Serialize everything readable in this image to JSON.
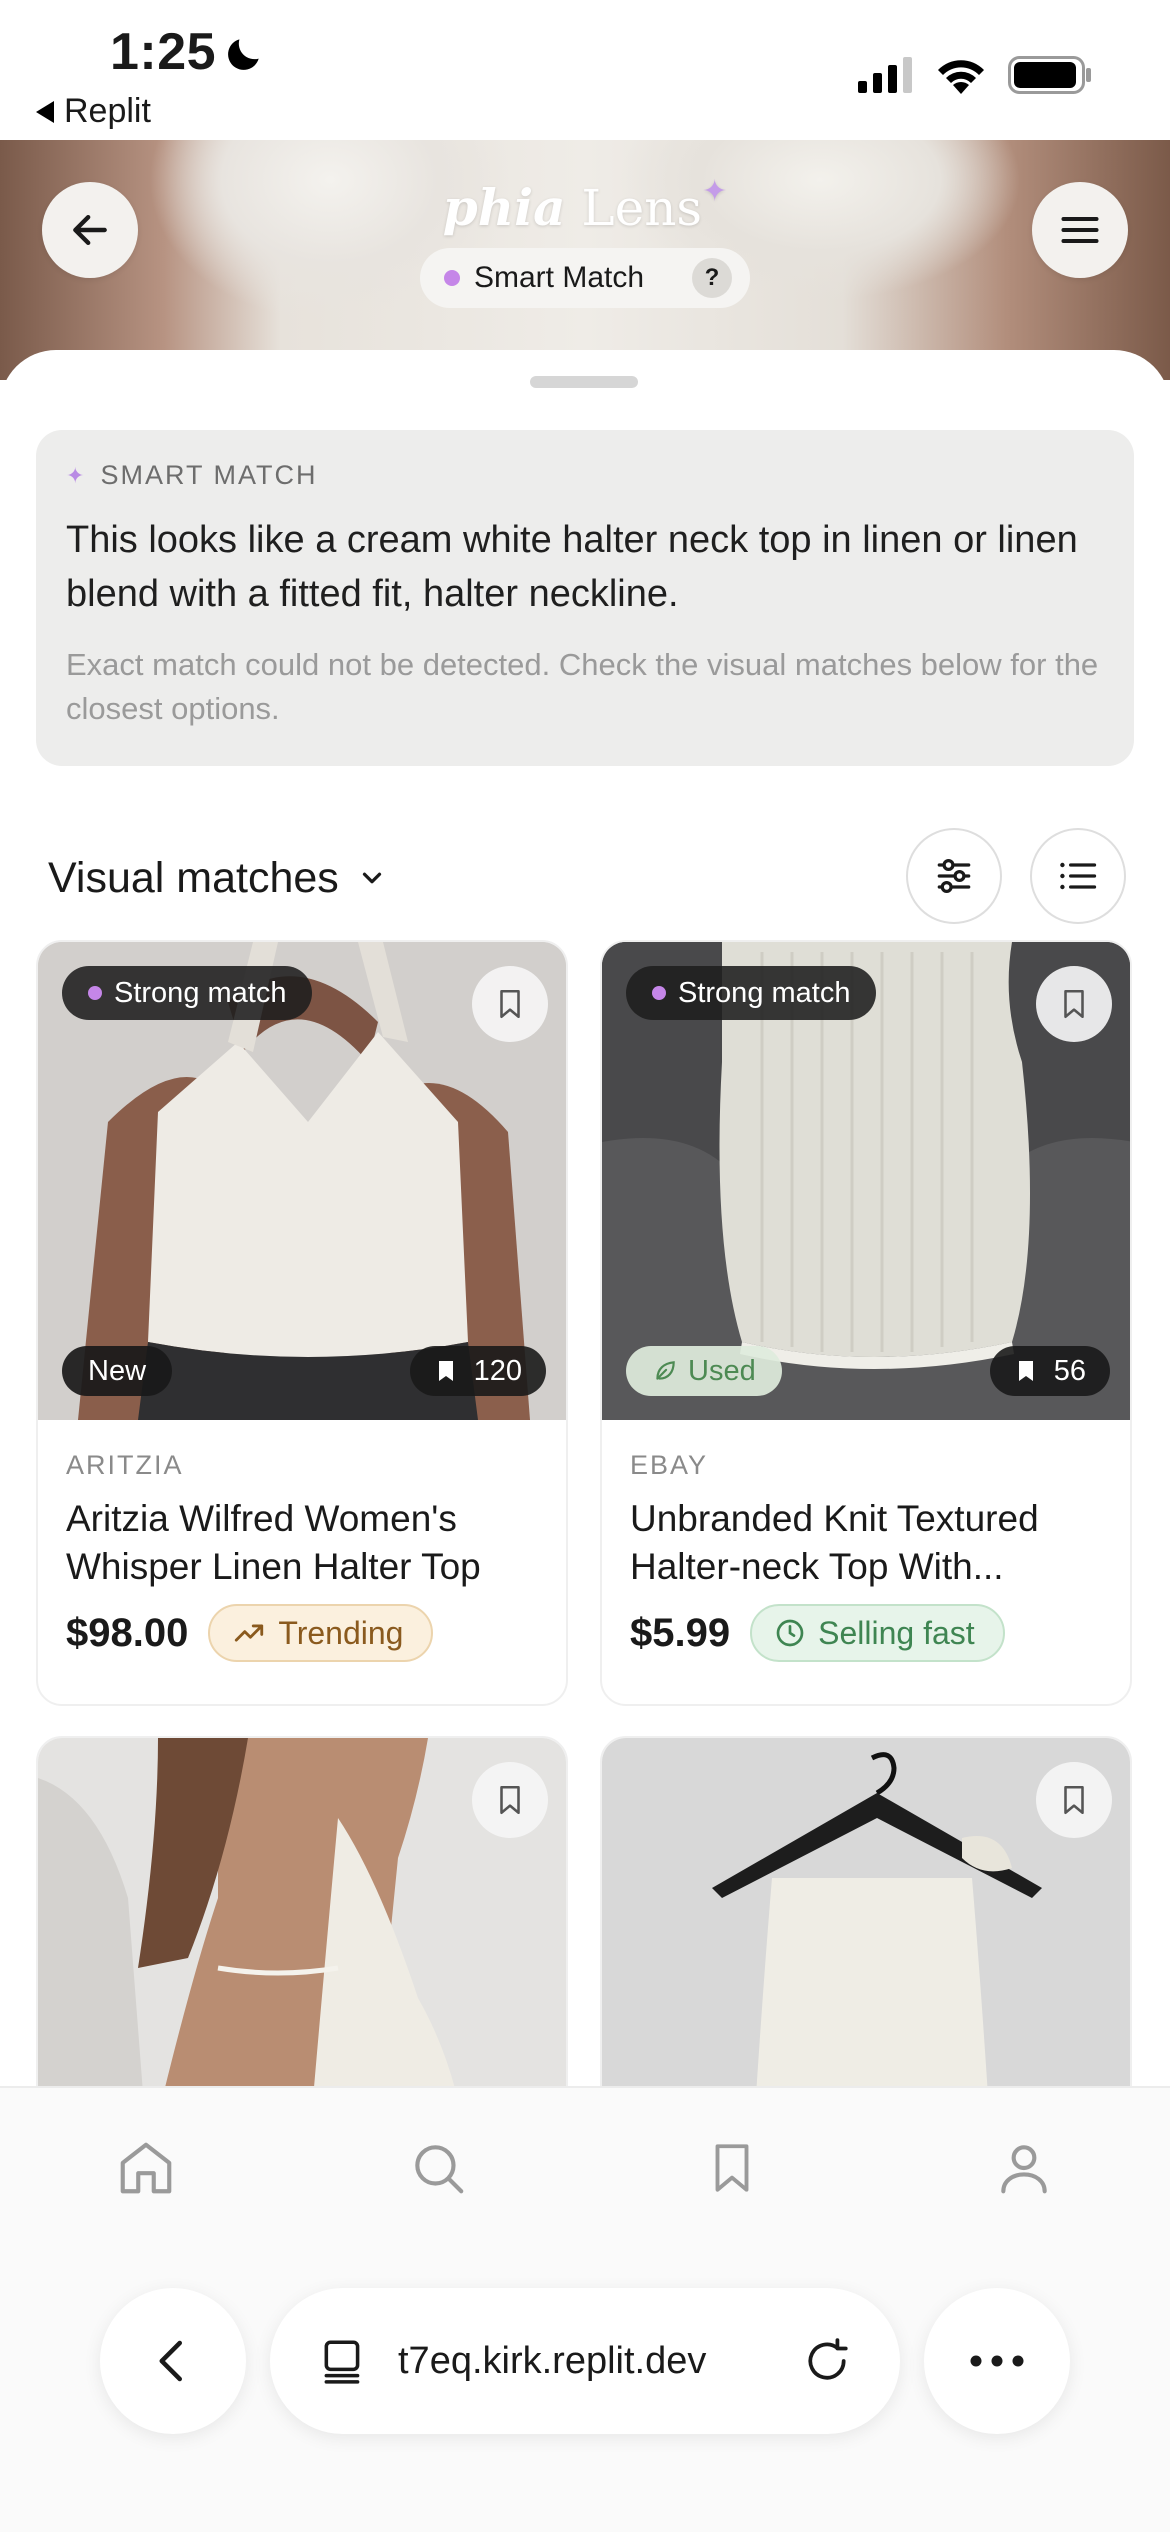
{
  "status_bar": {
    "time": "1:25",
    "back_app": "Replit"
  },
  "header": {
    "logo_italic": "phia",
    "logo_rest": "Lens",
    "mode_label": "Smart Match",
    "help_label": "?"
  },
  "smart_match": {
    "label": "SMART MATCH",
    "description": "This looks like a cream white halter neck top in linen or linen blend with a fitted fit, halter neckline.",
    "note": "Exact match could not be detected. Check the visual matches below for the closest options."
  },
  "results": {
    "section_title": "Visual matches",
    "products": [
      {
        "match_label": "Strong match",
        "condition": "New",
        "saves": "120",
        "brand": "ARITZIA",
        "title": "Aritzia Wilfred Women's Whisper Linen Halter Top",
        "price": "$98.00",
        "badge": "Trending"
      },
      {
        "match_label": "Strong match",
        "condition": "Used",
        "saves": "56",
        "brand": "EBAY",
        "title": "Unbranded Knit Textured Halter-neck Top With...",
        "price": "$5.99",
        "badge": "Selling fast"
      }
    ]
  },
  "browser": {
    "url": "t7eq.kirk.replit.dev"
  },
  "colors": {
    "accent_purple": "#c586e8",
    "trending_bg": "#fbf0de",
    "selling_fast_bg": "#e7f4ea"
  }
}
